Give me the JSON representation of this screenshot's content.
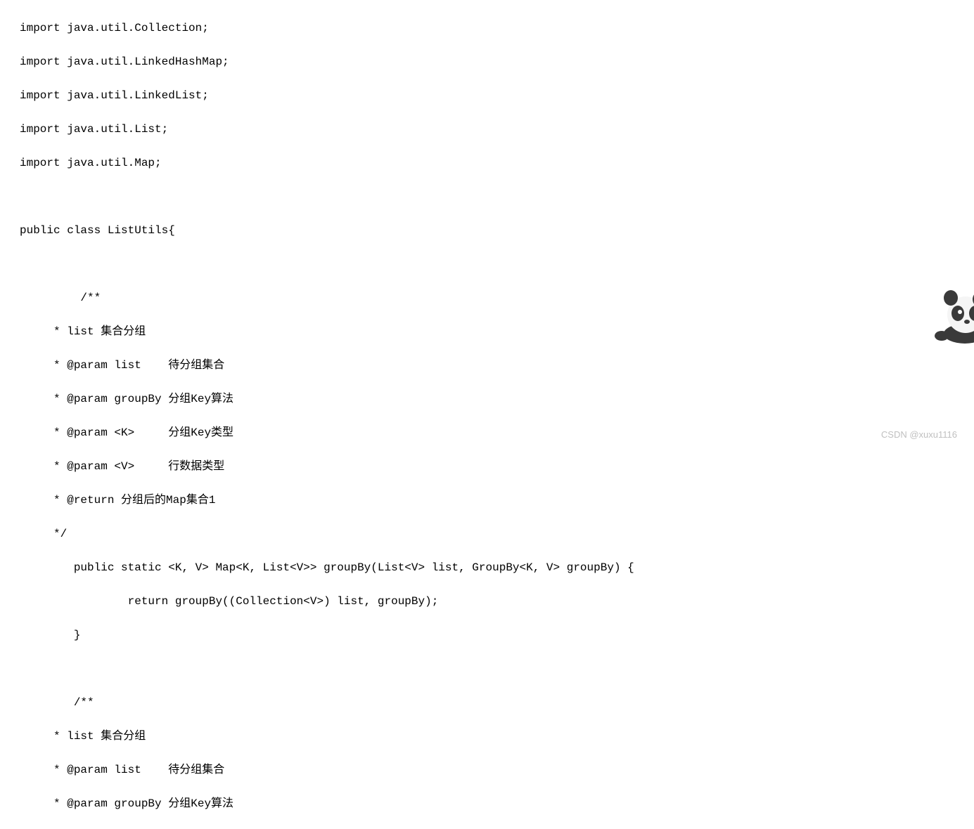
{
  "code": {
    "lines": [
      "import java.util.Collection;",
      "import java.util.LinkedHashMap;",
      "import java.util.LinkedList;",
      "import java.util.List;",
      "import java.util.Map;",
      "",
      "public class ListUtils{",
      "",
      "         /**",
      "     * list 集合分组",
      "     * @param list    待分组集合",
      "     * @param groupBy 分组Key算法",
      "     * @param <K>     分组Key类型",
      "     * @param <V>     行数据类型",
      "     * @return 分组后的Map集合1",
      "     */",
      "        public static <K, V> Map<K, List<V>> groupBy(List<V> list, GroupBy<K, V> groupBy) {",
      "                return groupBy((Collection<V>) list, groupBy);",
      "        }",
      "",
      "        /**",
      "     * list 集合分组",
      "     * @param list    待分组集合",
      "     * @param groupBy 分组Key算法"
    ]
  },
  "watermark": "CSDN @xuxu1116"
}
